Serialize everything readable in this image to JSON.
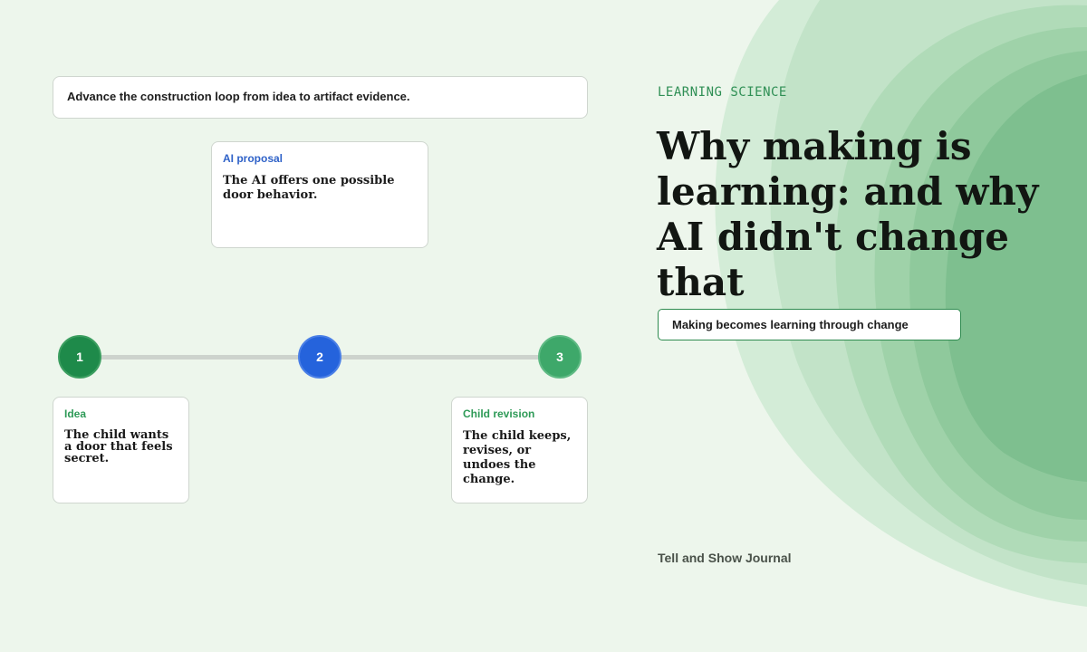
{
  "prompt": "Advance the construction loop from idea to artifact evidence.",
  "cards": {
    "ai": {
      "label": "AI proposal",
      "body": "The AI offers one possible door behavior."
    },
    "idea": {
      "label": "Idea",
      "body": "The child wants a door that feels secret."
    },
    "child": {
      "label": "Child revision",
      "body": "The child keeps, revises, or undoes the change."
    }
  },
  "steps": [
    "1",
    "2",
    "3"
  ],
  "kicker": "LEARNING SCIENCE",
  "headline": "Why making is learning: and why AI didn't change that",
  "subtitle_pill": "Making becomes learning through change",
  "footer": "Tell and Show Journal",
  "colors": {
    "background": "#edf6ec",
    "step1": "#1e8a4a",
    "step2": "#2563dc",
    "step3": "#3ea86a",
    "accent_green": "#2e9a57",
    "accent_blue": "#2f62c8"
  }
}
